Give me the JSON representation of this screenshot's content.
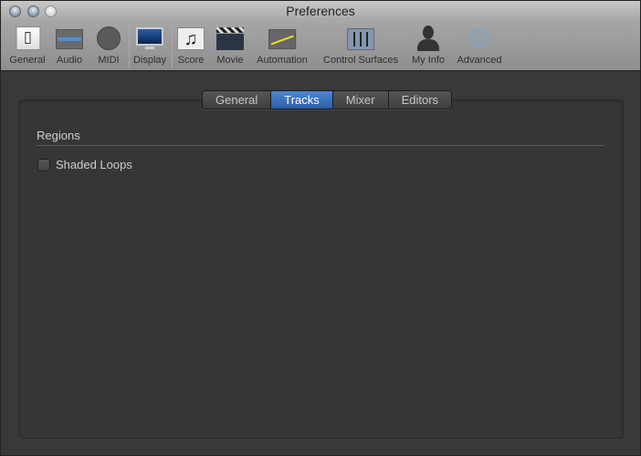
{
  "window": {
    "title": "Preferences"
  },
  "toolbar": {
    "items": [
      {
        "label": "General",
        "icon": "switch-icon"
      },
      {
        "label": "Audio",
        "icon": "waveform-icon"
      },
      {
        "label": "MIDI",
        "icon": "midi-plug-icon"
      },
      {
        "label": "Display",
        "icon": "monitor-icon"
      },
      {
        "label": "Score",
        "icon": "music-notes-icon"
      },
      {
        "label": "Movie",
        "icon": "clapperboard-icon"
      },
      {
        "label": "Automation",
        "icon": "automation-curve-icon"
      },
      {
        "label": "Control Surfaces",
        "icon": "faders-icon"
      },
      {
        "label": "My Info",
        "icon": "person-icon"
      },
      {
        "label": "Advanced",
        "icon": "gear-icon"
      }
    ]
  },
  "tabs": [
    {
      "label": "General"
    },
    {
      "label": "Tracks",
      "selected": true
    },
    {
      "label": "Mixer"
    },
    {
      "label": "Editors"
    }
  ],
  "content": {
    "section_title": "Regions",
    "checkbox_label": "Shaded Loops",
    "checkbox_checked": false
  },
  "colors": {
    "accent": "#2f67b4"
  }
}
